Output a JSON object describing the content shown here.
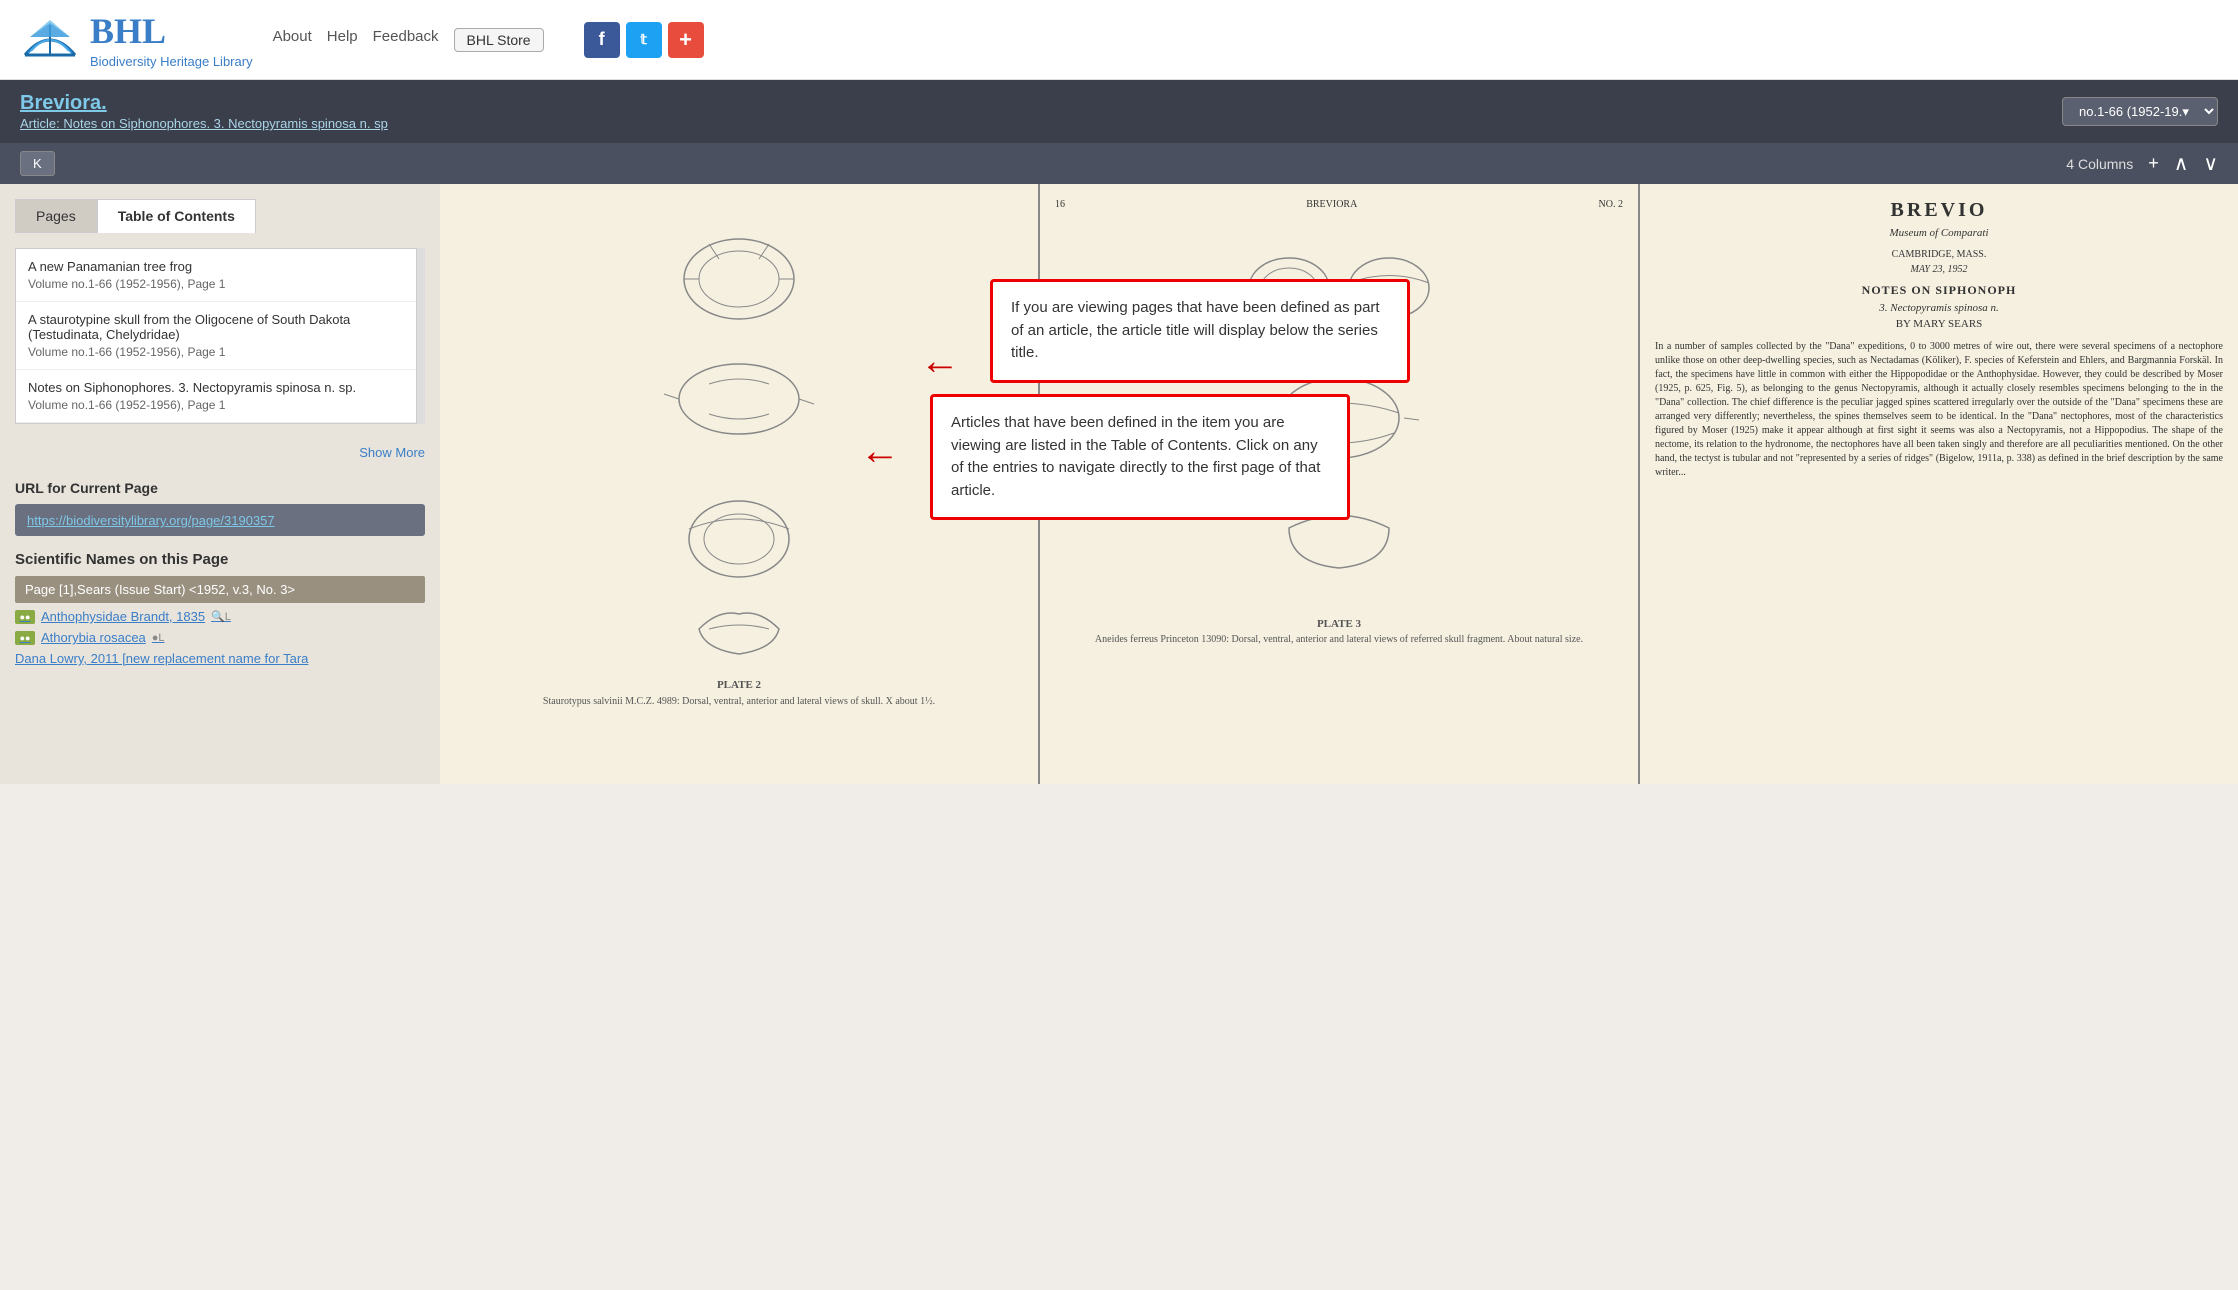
{
  "header": {
    "bhl_text": "BHL",
    "tagline": "Biodiversity Heritage Library",
    "nav": [
      "About",
      "Help",
      "Feedback"
    ],
    "store_label": "BHL Store",
    "social": [
      "f",
      "𝕥",
      "+"
    ]
  },
  "title_bar": {
    "title": "Breviora.",
    "article_link": "Article: Notes on Siphonophores. 3. Nectopyramis spinosa n. sp",
    "volume_selector": "no.1-66 (1952-19.▾"
  },
  "toolbar": {
    "k_button": "K",
    "columns_label": "4 Columns",
    "add_col": "+",
    "nav_up": "∧",
    "nav_down": "∨"
  },
  "sidebar": {
    "tabs": [
      "Pages",
      "Table of Contents"
    ],
    "toc_items": [
      {
        "title": "A new Panamanian tree frog",
        "meta": "Volume no.1-66 (1952-1956), Page 1"
      },
      {
        "title": "A staurotypine skull from the Oligocene of South Dakota (Testudinata, Chelydridae)",
        "meta": "Volume no.1-66 (1952-1956), Page 1"
      },
      {
        "title": "Notes on Siphonophores. 3. Nectopyramis spinosa n. sp.",
        "meta": "Volume no.1-66 (1952-1956), Page 1"
      }
    ],
    "show_more": "Show More",
    "url_section_label": "URL for Current Page",
    "current_url": "https://biodiversitylibrary.org/page/3190357",
    "sci_names_label": "Scientific Names on this Page",
    "sci_name_header": "Page [1],Sears (Issue Start) <1952, v.3, No. 3>",
    "sci_names": [
      "Anthophysidae Brandt, 1835",
      "Athorybia rosacea",
      "Dana Lowry, 2011 [new replacement name for Tara"
    ]
  },
  "tooltips": [
    {
      "id": "tooltip-1",
      "text": "If you are viewing pages that have been defined as part of an article, the article title will display below the series title."
    },
    {
      "id": "tooltip-2",
      "text": "Articles that have been defined in the item you are viewing are listed in the Table of Contents. Click on any of the entries to navigate directly to the first page of that article."
    }
  ],
  "pages": [
    {
      "id": "page-1",
      "top_text": "PLATE 2",
      "caption": "Staurotypus salvinii M.C.Z. 4989: Dorsal, ventral, anterior and lateral views of skull.  X about 1½."
    },
    {
      "id": "page-2",
      "number": "16",
      "brand": "BREVIORA",
      "issue": "NO. 2",
      "plate": "PLATE 3",
      "caption": "Aneides ferreus Princeton 13090: Dorsal, ventral, anterior and lateral views of referred skull fragment.  About natural size."
    },
    {
      "id": "page-3",
      "brand": "BREVIO",
      "subtitle": "Museum of Comparati",
      "location": "CAMBRIDGE, MASS.",
      "date": "MAY 23, 1952",
      "heading": "NOTES ON SIPHONOPH",
      "subheading": "3. Nectopyramis spinosa n.",
      "author": "BY MARY SEARS"
    }
  ]
}
